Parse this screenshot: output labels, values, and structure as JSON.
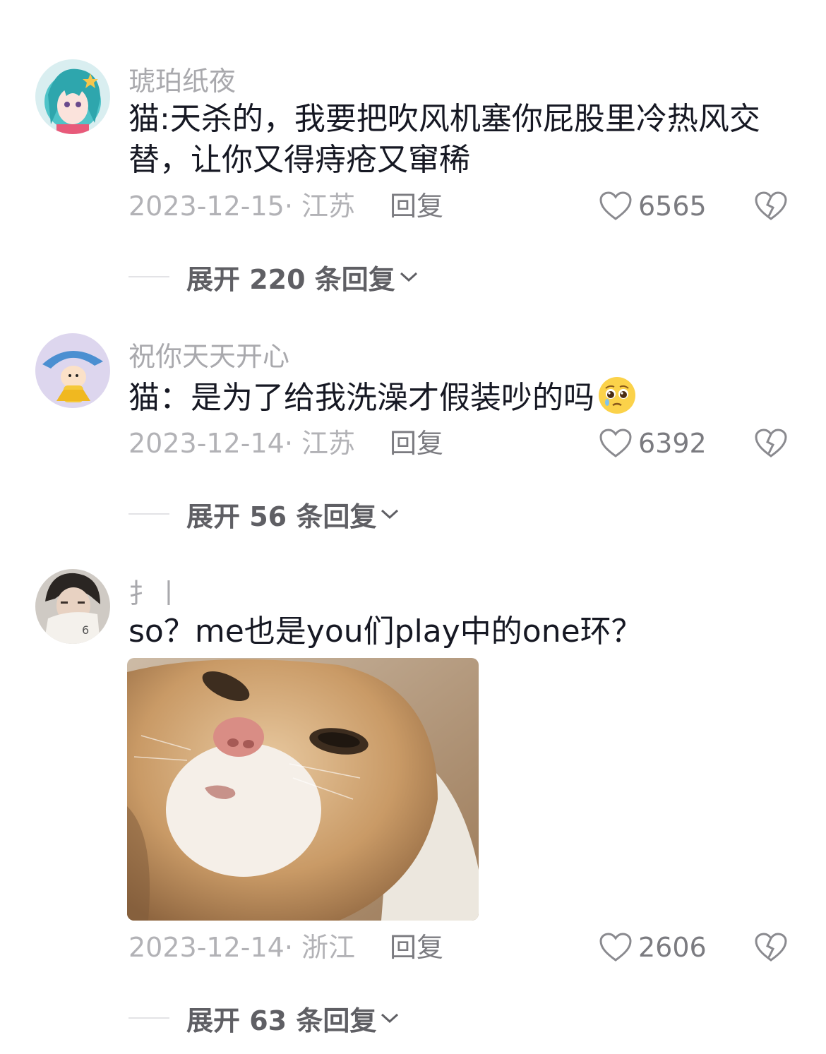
{
  "comments": [
    {
      "username": "琥珀纸夜",
      "content": "猫:天杀的，我要把吹风机塞你屁股里冷热风交替，让你又得痔疮又窜稀",
      "date_location": "2023-12-15· 江苏",
      "reply_label": "回复",
      "likes": "6565",
      "expand_label": "展开 220 条回复"
    },
    {
      "username": "祝你天天开心",
      "content": "猫：是为了给我洗澡才假装吵的吗",
      "content_emoji": "pleading-face-emoji",
      "date_location": "2023-12-14· 江苏",
      "reply_label": "回复",
      "likes": "6392",
      "expand_label": "展开 56 条回复"
    },
    {
      "username": "扌丨",
      "content": "so？me也是you们play中的one环？",
      "image": "wet-cat-photo",
      "date_location": "2023-12-14· 浙江",
      "reply_label": "回复",
      "likes": "2606",
      "expand_label": "展开 63 条回复"
    }
  ],
  "icons": {
    "like": "heart-outline-icon",
    "dislike": "broken-heart-icon",
    "expand": "chevron-down-icon"
  },
  "colors": {
    "username": "#a9a9ad",
    "meta": "#b2b2b6",
    "action": "#7b7b80",
    "expand": "#5f5f64"
  }
}
